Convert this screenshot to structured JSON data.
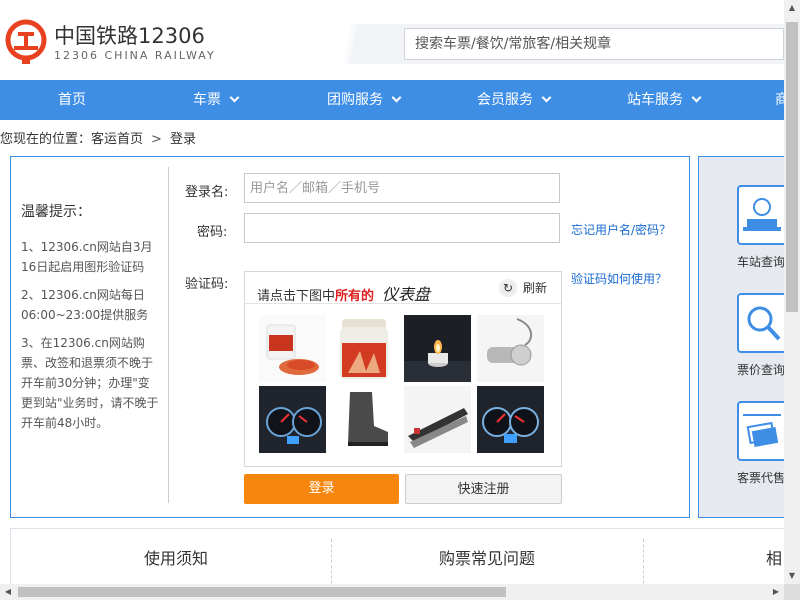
{
  "header": {
    "logo_title": "中国铁路12306",
    "logo_subtitle": "12306 CHINA RAILWAY",
    "search_placeholder": "搜索车票/餐饮/常旅客/相关规章",
    "brand_color": "#3e8ee6",
    "logo_color": "#e8411f"
  },
  "nav": {
    "items": [
      {
        "label": "首页",
        "has_dropdown": false
      },
      {
        "label": "车票",
        "has_dropdown": true
      },
      {
        "label": "团购服务",
        "has_dropdown": true
      },
      {
        "label": "会员服务",
        "has_dropdown": true
      },
      {
        "label": "站车服务",
        "has_dropdown": true
      },
      {
        "label": "商",
        "has_dropdown": false
      }
    ]
  },
  "breadcrumb": {
    "prefix": "您现在的位置：",
    "home": "客运首页",
    "separator": ">",
    "current": "登录"
  },
  "tips": {
    "title": "温馨提示：",
    "items": [
      "1、12306.cn网站自3月16日起启用图形验证码",
      "2、12306.cn网站每日06:00~23:00提供服务",
      "3、在12306.cn网站购票、改签和退票须不晚于开车前30分钟；办理\"变更到站\"业务时，请不晚于开车前48小时。"
    ]
  },
  "form": {
    "username_label": "登录名:",
    "username_placeholder": "用户名／邮箱／手机号",
    "username_value": "",
    "password_label": "密码:",
    "password_value": "",
    "forgot_link": "忘记用户名/密码？",
    "captcha_label": "验证码:",
    "captcha_help_link": "验证码如何使用？",
    "login_button": "登录",
    "register_button": "快速注册",
    "login_color": "#f7860f"
  },
  "captcha": {
    "prompt_prefix": "请点击下图中",
    "prompt_emphasis": "所有的",
    "target_word": "仪表盘",
    "refresh_label": "刷新",
    "images": [
      "chili-powder-jar",
      "chili-powder-jar",
      "candle",
      "whistle",
      "dashboard",
      "boot",
      "stapler",
      "dashboard"
    ]
  },
  "side_panel": {
    "items": [
      {
        "label": "车站查询",
        "icon": "station-icon"
      },
      {
        "label": "票价查询",
        "icon": "search-icon"
      },
      {
        "label": "客票代售",
        "icon": "ticket-icon"
      }
    ]
  },
  "bottom_links": [
    "使用须知",
    "购票常见问题",
    "相"
  ]
}
